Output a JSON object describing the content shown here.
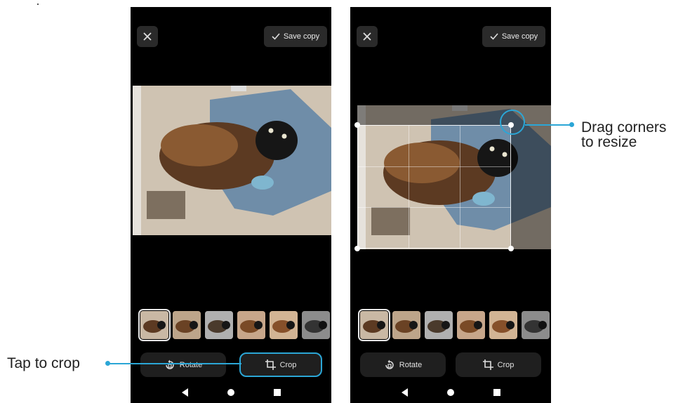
{
  "left_phone": {
    "save_copy_label": "Save copy",
    "rotate_label": "Rotate",
    "crop_label": "Crop"
  },
  "right_phone": {
    "save_copy_label": "Save copy",
    "rotate_label": "Rotate",
    "crop_label": "Crop"
  },
  "callouts": {
    "tap_to_crop": "Tap to crop",
    "drag_corners_line1": "Drag corners",
    "drag_corners_line2": "to resize"
  },
  "icons": {
    "close": "close-icon",
    "save": "check-icon",
    "rotate": "rotate-icon",
    "crop": "crop-icon",
    "nav_back": "nav-back-icon",
    "nav_home": "nav-home-icon",
    "nav_recent": "nav-recent-icon"
  },
  "colors": {
    "accent": "#2ba6d6",
    "background": "#000000",
    "button_bg": "#1f1f1f"
  }
}
